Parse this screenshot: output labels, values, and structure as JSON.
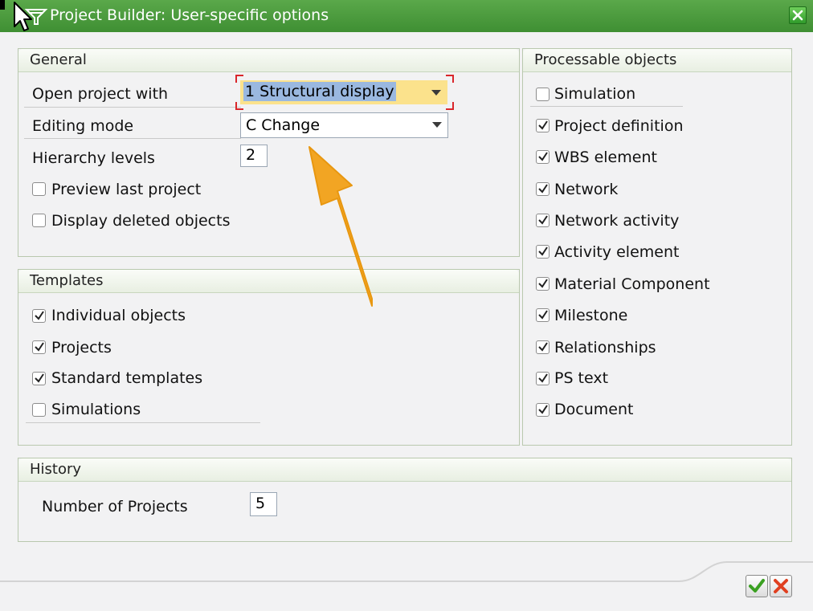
{
  "window": {
    "title": "Project Builder: User-specific options"
  },
  "general": {
    "heading": "General",
    "open_project_label": "Open project with",
    "open_project_value": "1 Structural display",
    "editing_mode_label": "Editing mode",
    "editing_mode_value": "C Change",
    "hierarchy_label": "Hierarchy levels",
    "hierarchy_value": "2",
    "preview_label": "Preview last project",
    "preview_checked": false,
    "display_deleted_label": "Display deleted objects",
    "display_deleted_checked": false
  },
  "templates": {
    "heading": "Templates",
    "items": [
      {
        "label": "Individual objects",
        "checked": true
      },
      {
        "label": "Projects",
        "checked": true
      },
      {
        "label": "Standard templates",
        "checked": true
      },
      {
        "label": "Simulations",
        "checked": false
      }
    ]
  },
  "processable": {
    "heading": "Processable objects",
    "items": [
      {
        "label": "Simulation",
        "checked": false
      },
      {
        "label": "Project definition",
        "checked": true
      },
      {
        "label": "WBS element",
        "checked": true
      },
      {
        "label": "Network",
        "checked": true
      },
      {
        "label": "Network activity",
        "checked": true
      },
      {
        "label": "Activity element",
        "checked": true
      },
      {
        "label": "Material Component",
        "checked": true
      },
      {
        "label": "Milestone",
        "checked": true
      },
      {
        "label": "Relationships",
        "checked": true
      },
      {
        "label": "PS text",
        "checked": true
      },
      {
        "label": "Document",
        "checked": true
      }
    ]
  },
  "history": {
    "heading": "History",
    "num_projects_label": "Number of Projects",
    "num_projects_value": "5"
  },
  "colors": {
    "title_bar": "#4a9a3c",
    "selection": "#9ab8e0",
    "focus_field": "#fbe28c",
    "focus_marker": "#d9262b",
    "annotation_arrow": "#f2a523"
  }
}
